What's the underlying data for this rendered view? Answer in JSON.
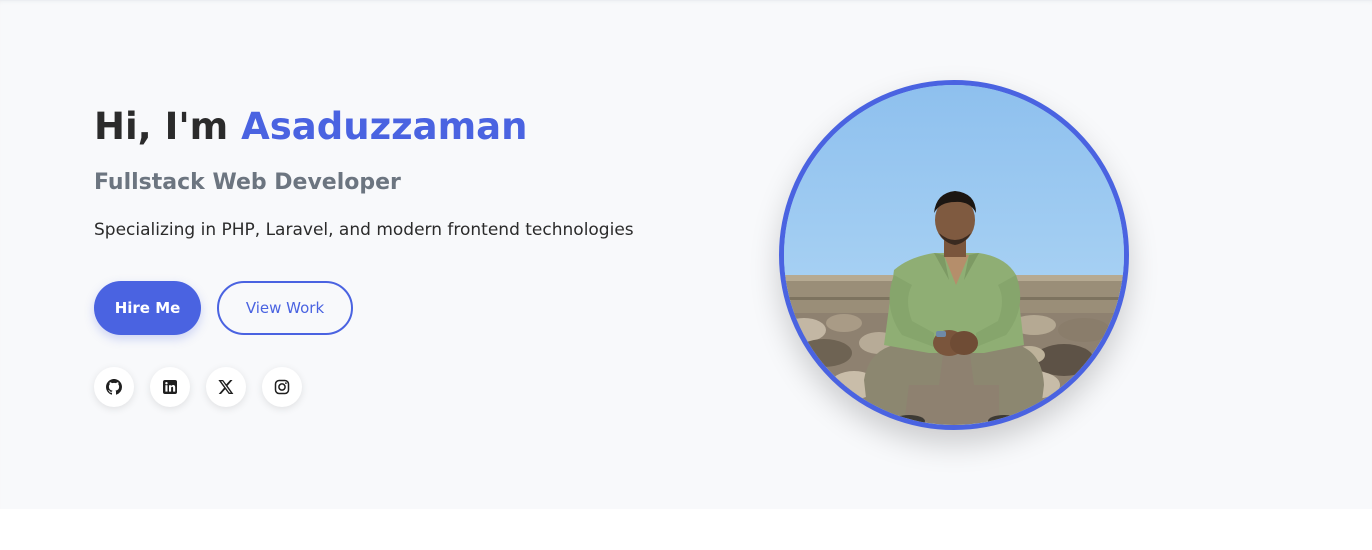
{
  "hero": {
    "greeting": "Hi, I'm ",
    "name": "Asaduzzaman",
    "role": "Fullstack Web Developer",
    "description": "Specializing in PHP, Laravel, and modern frontend technologies",
    "hire_label": "Hire Me",
    "work_label": "View Work"
  },
  "socials": [
    {
      "icon": "github-icon"
    },
    {
      "icon": "linkedin-icon"
    },
    {
      "icon": "x-icon"
    },
    {
      "icon": "instagram-icon"
    }
  ],
  "colors": {
    "accent": "#4a63e1",
    "text": "#2b2b2b",
    "muted": "#6c7580",
    "background": "#f8f9fb"
  }
}
